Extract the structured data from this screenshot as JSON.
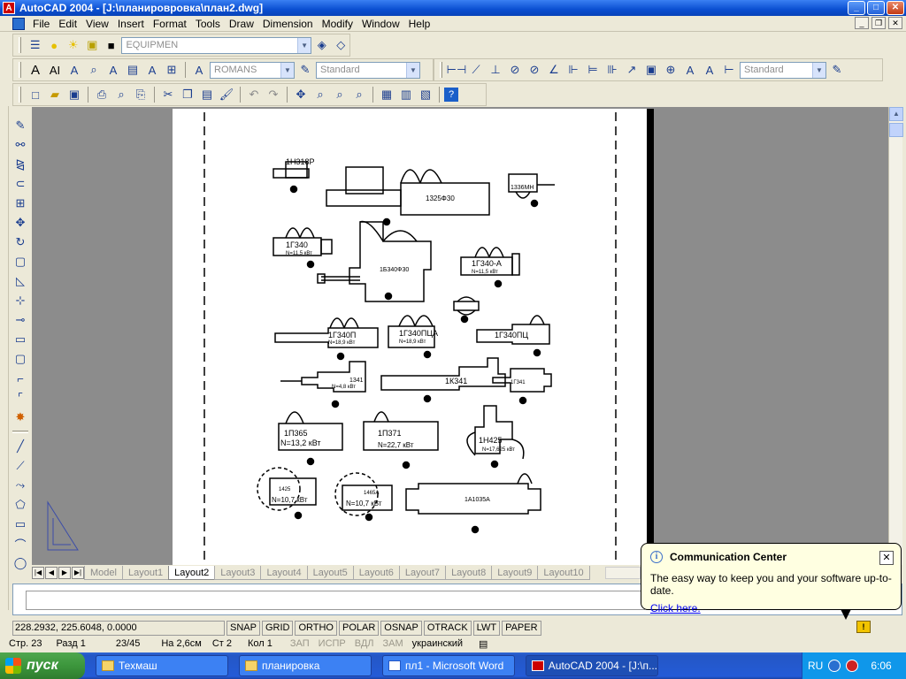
{
  "window": {
    "title": "AutoCAD 2004 - [J:\\планировровка\\план2.dwg]",
    "app_icon": "A"
  },
  "menu": [
    "File",
    "Edit",
    "View",
    "Insert",
    "Format",
    "Tools",
    "Draw",
    "Dimension",
    "Modify",
    "Window",
    "Help"
  ],
  "layer": {
    "value": "EQUIPMEN"
  },
  "text_style": {
    "value": "ROMANS"
  },
  "dim_style": {
    "value": "Standard"
  },
  "style3": {
    "value": "Standard"
  },
  "drawing": {
    "labels": [
      "1Н318Р",
      "1325Ф30",
      "1336МН",
      "1Г340",
      "N=11,5 кВт",
      "1Б340Ф30",
      "1Г340-А",
      "N=11,5 кВт",
      "1Г340П",
      "N=18,9 кВт",
      "1Г340ПЦ",
      "1Г340ПЦА",
      "N=18,9 кВт",
      "1341",
      "N=4,8 кВт",
      "1К341",
      "1Г341",
      "1П365",
      "N=13,2 кВт",
      "1П371",
      "N=22,7 кВт",
      "1Н425",
      "N=17,625 кВт",
      "1425",
      "N=10,7 кВт",
      "1465А",
      "N=10,7 кВт",
      "1А1035А"
    ]
  },
  "tabs": {
    "model": "Model",
    "items": [
      "Layout1",
      "Layout2",
      "Layout3",
      "Layout4",
      "Layout5",
      "Layout6",
      "Layout7",
      "Layout8",
      "Layout9",
      "Layout10"
    ],
    "active": "Layout2"
  },
  "status": {
    "coords": "228.2932, 225.6048, 0.0000",
    "toggles": [
      "SNAP",
      "GRID",
      "ORTHO",
      "POLAR",
      "OSNAP",
      "OTRACK",
      "LWT",
      "PAPER"
    ]
  },
  "word_status": {
    "page": "Стр. 23",
    "section": "Разд 1",
    "pos": "23/45",
    "at": "На 2,6см",
    "line": "Ст 2",
    "col": "Кол 1",
    "zap": "ЗАП",
    "ispr": "ИСПР",
    "vdl": "ВДЛ",
    "zam": "ЗАМ",
    "lang": "украинский"
  },
  "balloon": {
    "title": "Communication Center",
    "message": "The easy way to keep you and your software up-to-date.",
    "link": "Click here."
  },
  "taskbar": {
    "start": "пуск",
    "tasks": [
      "Техмаш",
      "планировка",
      "пл1 - Microsoft Word",
      "AutoCAD 2004 - [J:\\п..."
    ],
    "lang": "RU",
    "time": "6:06"
  }
}
